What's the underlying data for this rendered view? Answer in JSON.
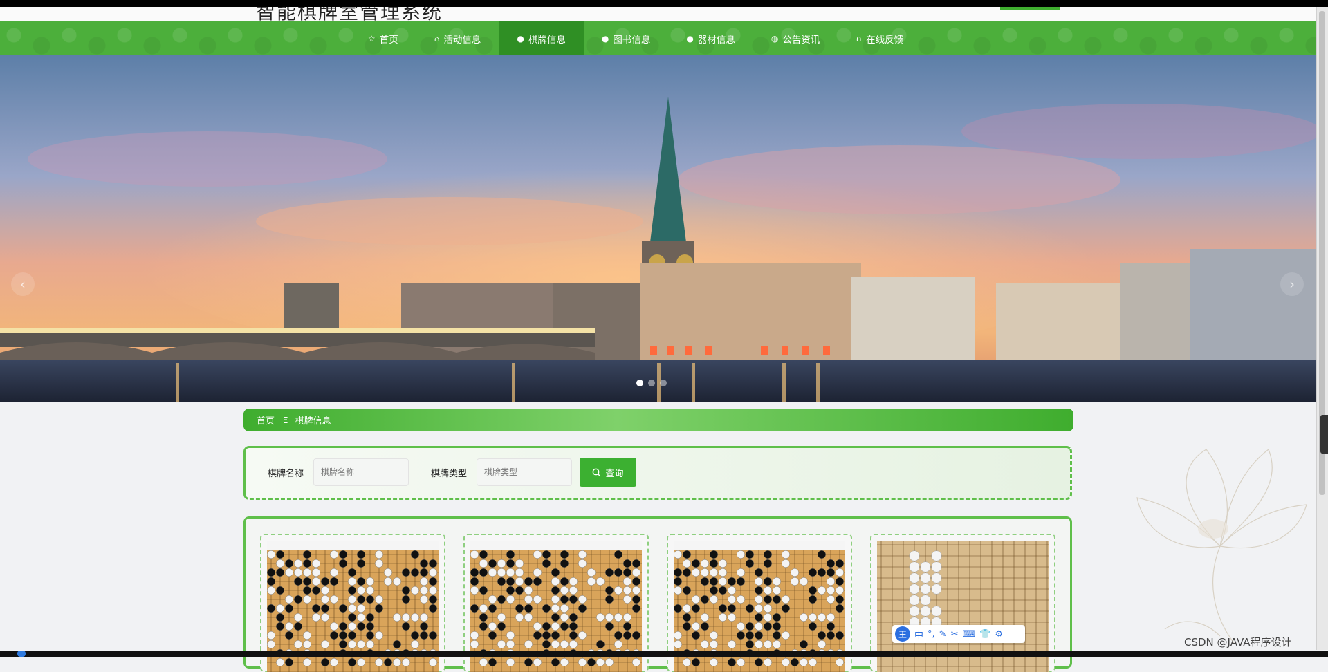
{
  "header": {
    "title": "智能棋牌室管理系统"
  },
  "nav": {
    "items": [
      {
        "label": "首页",
        "icon": "star-icon",
        "glyph": "☆"
      },
      {
        "label": "活动信息",
        "icon": "bag-icon",
        "glyph": "⌂"
      },
      {
        "label": "棋牌信息",
        "icon": "info-icon",
        "glyph": "●",
        "active": true
      },
      {
        "label": "图书信息",
        "icon": "help-icon",
        "glyph": "●"
      },
      {
        "label": "器材信息",
        "icon": "info-icon",
        "glyph": "●"
      },
      {
        "label": "公告资讯",
        "icon": "globe-icon",
        "glyph": "◍"
      },
      {
        "label": "在线反馈",
        "icon": "headset-icon",
        "glyph": "∩"
      }
    ]
  },
  "banner": {
    "prev_glyph": "‹",
    "next_glyph": "›",
    "slides": 3,
    "active_slide": 1
  },
  "breadcrumb": {
    "home": "首页",
    "separator": "Ξ",
    "current": "棋牌信息"
  },
  "search": {
    "name_label": "棋牌名称",
    "name_placeholder": "棋牌名称",
    "type_label": "棋牌类型",
    "type_placeholder": "棋牌类型",
    "button_label": "查询"
  },
  "ime": {
    "badge": "王",
    "lang": "中",
    "items": [
      "°,",
      "✎",
      "✂",
      "⌨",
      "👕",
      "⚙"
    ]
  },
  "watermark": "CSDN @JAVA程序设计",
  "colors": {
    "primary": "#4caf3b",
    "nav_active": "#2f8f24",
    "button": "#3cb031",
    "board": "#d9a45a"
  }
}
